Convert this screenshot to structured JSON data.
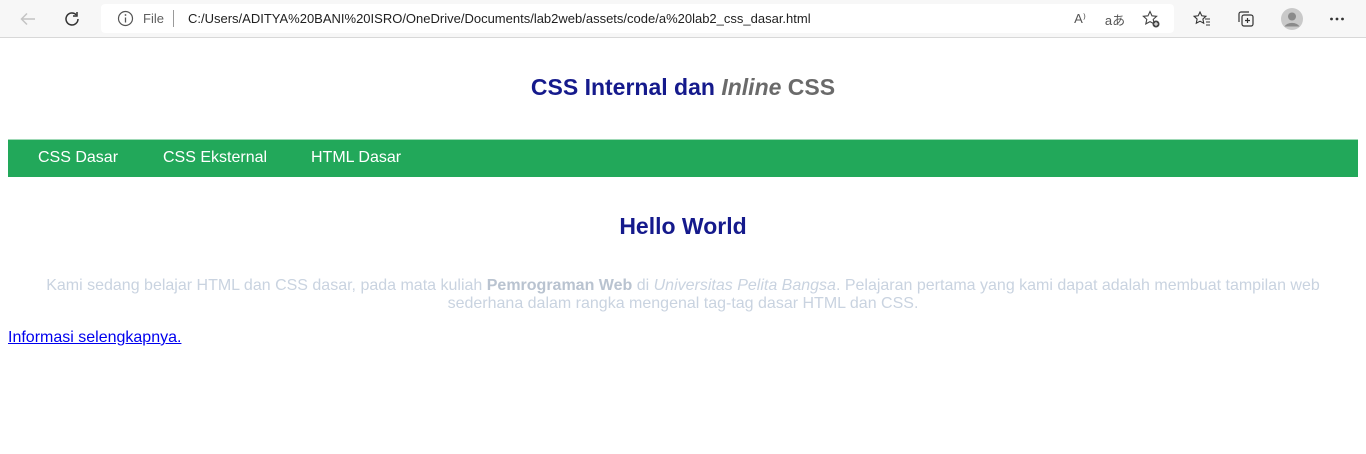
{
  "browser": {
    "scheme_label": "File",
    "url": "C:/Users/ADITYA%20BANI%20ISRO/OneDrive/Documents/lab2web/assets/code/a%20lab2_css_dasar.html",
    "read_aloud_text": "A⁾",
    "translate_text": "aあ",
    "icons": [
      "back-icon",
      "refresh-icon",
      "info-icon",
      "read-aloud-icon",
      "translate-icon",
      "add-favorite-icon",
      "favorites-icon",
      "collections-icon",
      "profile-avatar-icon",
      "more-menu-icon"
    ]
  },
  "page": {
    "title_main": "CSS Internal dan ",
    "title_inline_em": "Inline",
    "title_inline_rest": " CSS",
    "nav": [
      "CSS Dasar",
      "CSS Eksternal",
      "HTML Dasar"
    ],
    "heading": "Hello World",
    "paragraph": {
      "part1": "Kami sedang belajar HTML dan CSS dasar, pada mata kuliah ",
      "bold": "Pemrograman Web",
      "part2": " di ",
      "italic": "Universitas Pelita Bangsa",
      "part3": ". Pelajaran pertama yang kami dapat adalah membuat tampilan web sederhana dalam rangka mengenal tag-tag dasar HTML dan CSS."
    },
    "link": "Informasi selengkapnya."
  },
  "colors": {
    "heading": "#151a8c",
    "nav_bg": "#22a85a",
    "paragraph": "#c9d3e0",
    "link": "#0000ee"
  }
}
